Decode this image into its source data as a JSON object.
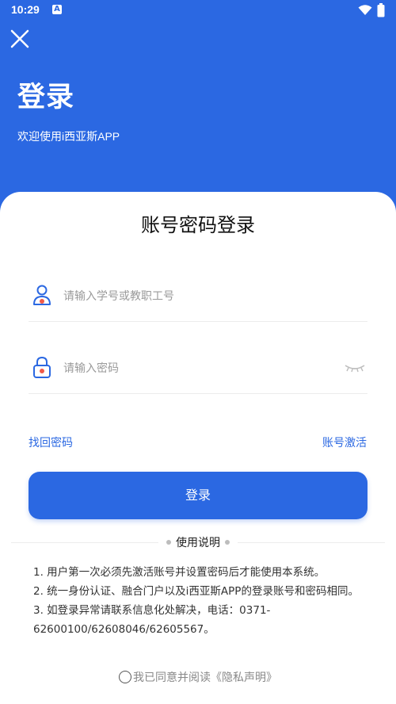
{
  "status_bar": {
    "time": "10:29",
    "notification_icon": "A"
  },
  "header": {
    "close_icon": "close-icon",
    "title": "登录",
    "subtitle": "欢迎使用i西亚斯APP"
  },
  "card": {
    "title": "账号密码登录",
    "username": {
      "placeholder": "请输入学号或教职工号",
      "icon": "user-icon"
    },
    "password": {
      "placeholder": "请输入密码",
      "icon": "lock-icon",
      "toggle_icon": "eye-closed-icon"
    },
    "forgot_label": "找回密码",
    "activate_label": "账号激活",
    "login_label": "登录"
  },
  "usage": {
    "heading": "使用说明",
    "notes": [
      "1. 用户第一次必须先激活账号并设置密码后才能使用本系统。",
      "2. 统一身份认证、融合门户以及i西亚斯APP的登录账号和密码相同。",
      "3. 如登录异常请联系信息化处解决，电话：0371-62600100/62608046/62605567。"
    ]
  },
  "agreement": {
    "text": "我已同意并阅读",
    "link": "《隐私声明》"
  },
  "colors": {
    "primary": "#2b68e2",
    "card": "#ffffff",
    "placeholder": "#9a9a9a"
  }
}
